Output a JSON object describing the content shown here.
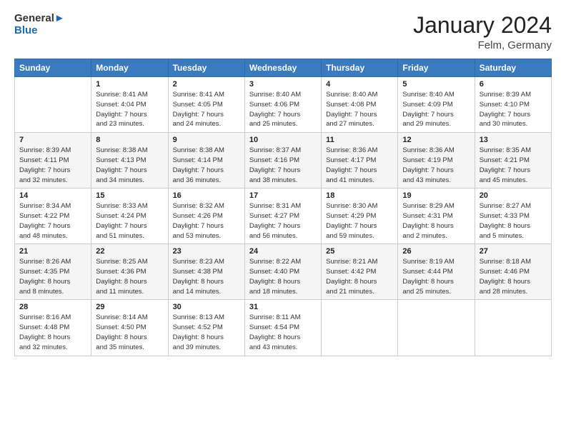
{
  "header": {
    "logo_line1": "General",
    "logo_line2": "Blue",
    "title": "January 2024",
    "subtitle": "Felm, Germany"
  },
  "days_of_week": [
    "Sunday",
    "Monday",
    "Tuesday",
    "Wednesday",
    "Thursday",
    "Friday",
    "Saturday"
  ],
  "weeks": [
    [
      {
        "day": "",
        "info": ""
      },
      {
        "day": "1",
        "info": "Sunrise: 8:41 AM\nSunset: 4:04 PM\nDaylight: 7 hours\nand 23 minutes."
      },
      {
        "day": "2",
        "info": "Sunrise: 8:41 AM\nSunset: 4:05 PM\nDaylight: 7 hours\nand 24 minutes."
      },
      {
        "day": "3",
        "info": "Sunrise: 8:40 AM\nSunset: 4:06 PM\nDaylight: 7 hours\nand 25 minutes."
      },
      {
        "day": "4",
        "info": "Sunrise: 8:40 AM\nSunset: 4:08 PM\nDaylight: 7 hours\nand 27 minutes."
      },
      {
        "day": "5",
        "info": "Sunrise: 8:40 AM\nSunset: 4:09 PM\nDaylight: 7 hours\nand 29 minutes."
      },
      {
        "day": "6",
        "info": "Sunrise: 8:39 AM\nSunset: 4:10 PM\nDaylight: 7 hours\nand 30 minutes."
      }
    ],
    [
      {
        "day": "7",
        "info": "Sunrise: 8:39 AM\nSunset: 4:11 PM\nDaylight: 7 hours\nand 32 minutes."
      },
      {
        "day": "8",
        "info": "Sunrise: 8:38 AM\nSunset: 4:13 PM\nDaylight: 7 hours\nand 34 minutes."
      },
      {
        "day": "9",
        "info": "Sunrise: 8:38 AM\nSunset: 4:14 PM\nDaylight: 7 hours\nand 36 minutes."
      },
      {
        "day": "10",
        "info": "Sunrise: 8:37 AM\nSunset: 4:16 PM\nDaylight: 7 hours\nand 38 minutes."
      },
      {
        "day": "11",
        "info": "Sunrise: 8:36 AM\nSunset: 4:17 PM\nDaylight: 7 hours\nand 41 minutes."
      },
      {
        "day": "12",
        "info": "Sunrise: 8:36 AM\nSunset: 4:19 PM\nDaylight: 7 hours\nand 43 minutes."
      },
      {
        "day": "13",
        "info": "Sunrise: 8:35 AM\nSunset: 4:21 PM\nDaylight: 7 hours\nand 45 minutes."
      }
    ],
    [
      {
        "day": "14",
        "info": "Sunrise: 8:34 AM\nSunset: 4:22 PM\nDaylight: 7 hours\nand 48 minutes."
      },
      {
        "day": "15",
        "info": "Sunrise: 8:33 AM\nSunset: 4:24 PM\nDaylight: 7 hours\nand 51 minutes."
      },
      {
        "day": "16",
        "info": "Sunrise: 8:32 AM\nSunset: 4:26 PM\nDaylight: 7 hours\nand 53 minutes."
      },
      {
        "day": "17",
        "info": "Sunrise: 8:31 AM\nSunset: 4:27 PM\nDaylight: 7 hours\nand 56 minutes."
      },
      {
        "day": "18",
        "info": "Sunrise: 8:30 AM\nSunset: 4:29 PM\nDaylight: 7 hours\nand 59 minutes."
      },
      {
        "day": "19",
        "info": "Sunrise: 8:29 AM\nSunset: 4:31 PM\nDaylight: 8 hours\nand 2 minutes."
      },
      {
        "day": "20",
        "info": "Sunrise: 8:27 AM\nSunset: 4:33 PM\nDaylight: 8 hours\nand 5 minutes."
      }
    ],
    [
      {
        "day": "21",
        "info": "Sunrise: 8:26 AM\nSunset: 4:35 PM\nDaylight: 8 hours\nand 8 minutes."
      },
      {
        "day": "22",
        "info": "Sunrise: 8:25 AM\nSunset: 4:36 PM\nDaylight: 8 hours\nand 11 minutes."
      },
      {
        "day": "23",
        "info": "Sunrise: 8:23 AM\nSunset: 4:38 PM\nDaylight: 8 hours\nand 14 minutes."
      },
      {
        "day": "24",
        "info": "Sunrise: 8:22 AM\nSunset: 4:40 PM\nDaylight: 8 hours\nand 18 minutes."
      },
      {
        "day": "25",
        "info": "Sunrise: 8:21 AM\nSunset: 4:42 PM\nDaylight: 8 hours\nand 21 minutes."
      },
      {
        "day": "26",
        "info": "Sunrise: 8:19 AM\nSunset: 4:44 PM\nDaylight: 8 hours\nand 25 minutes."
      },
      {
        "day": "27",
        "info": "Sunrise: 8:18 AM\nSunset: 4:46 PM\nDaylight: 8 hours\nand 28 minutes."
      }
    ],
    [
      {
        "day": "28",
        "info": "Sunrise: 8:16 AM\nSunset: 4:48 PM\nDaylight: 8 hours\nand 32 minutes."
      },
      {
        "day": "29",
        "info": "Sunrise: 8:14 AM\nSunset: 4:50 PM\nDaylight: 8 hours\nand 35 minutes."
      },
      {
        "day": "30",
        "info": "Sunrise: 8:13 AM\nSunset: 4:52 PM\nDaylight: 8 hours\nand 39 minutes."
      },
      {
        "day": "31",
        "info": "Sunrise: 8:11 AM\nSunset: 4:54 PM\nDaylight: 8 hours\nand 43 minutes."
      },
      {
        "day": "",
        "info": ""
      },
      {
        "day": "",
        "info": ""
      },
      {
        "day": "",
        "info": ""
      }
    ]
  ]
}
